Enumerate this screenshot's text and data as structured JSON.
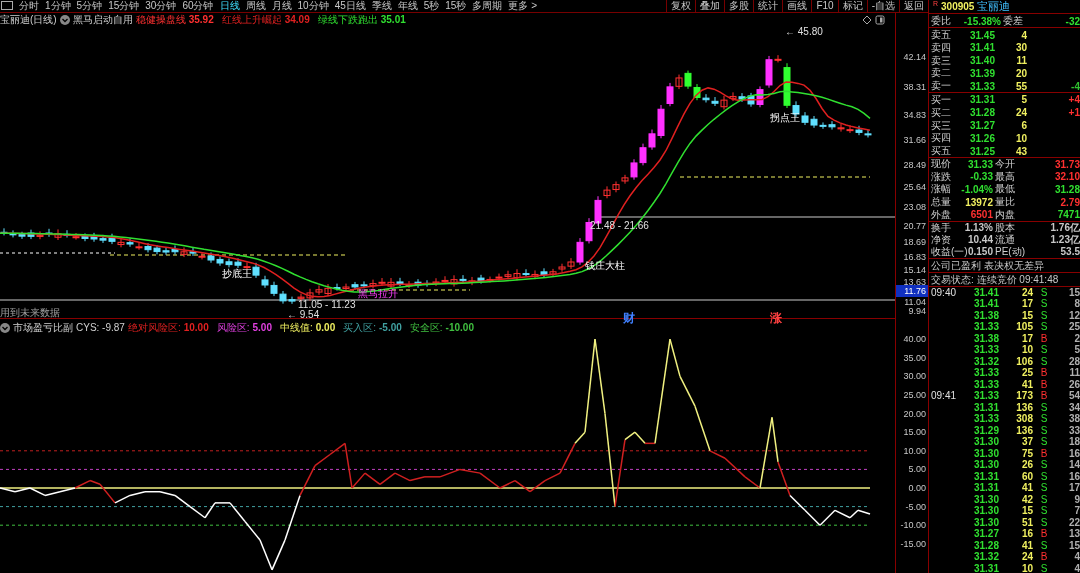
{
  "toolbar": {
    "periods": [
      {
        "label": "分时",
        "selected": false
      },
      {
        "label": "1分钟",
        "selected": false
      },
      {
        "label": "5分钟",
        "selected": false
      },
      {
        "label": "15分钟",
        "selected": false
      },
      {
        "label": "30分钟",
        "selected": false
      },
      {
        "label": "60分钟",
        "selected": false
      },
      {
        "label": "日线",
        "selected": true
      },
      {
        "label": "周线",
        "selected": false
      },
      {
        "label": "月线",
        "selected": false
      },
      {
        "label": "10分钟",
        "selected": false
      },
      {
        "label": "45日线",
        "selected": false
      },
      {
        "label": "季线",
        "selected": false
      },
      {
        "label": "年线",
        "selected": false
      },
      {
        "label": "5秒",
        "selected": false
      },
      {
        "label": "15秒",
        "selected": false
      },
      {
        "label": "多周期",
        "selected": false
      }
    ],
    "more": "更多 >",
    "tools": [
      "复权",
      "叠加",
      "多股",
      "统计",
      "画线",
      "F10",
      "标记",
      "-自选",
      "返回"
    ]
  },
  "price_chart": {
    "title": "宝丽迪(日线)",
    "indicator": "黑马启动自用",
    "readings": [
      {
        "label": "稳健操盘线",
        "value": "35.92",
        "color": "#ff3030"
      },
      {
        "label": "红线上升崛起",
        "value": "34.09",
        "color": "#e02020"
      },
      {
        "label": "绿线下跌跑出",
        "value": "35.01",
        "color": "#30e030"
      }
    ],
    "annotations": [
      {
        "text": "← 45.80",
        "kind": "price"
      },
      {
        "text": "拐点王",
        "kind": "signal"
      },
      {
        "text": "21.48 - 21.66",
        "kind": "price"
      },
      {
        "text": "钱庄大柱",
        "kind": "signal"
      },
      {
        "text": "抄底王",
        "kind": "signal"
      },
      {
        "text": "黑马拉升",
        "kind": "highlight"
      },
      {
        "text": "11.05 - 11.23",
        "kind": "price"
      },
      {
        "text": "← 9.54",
        "kind": "price"
      },
      {
        "text": "用到未来数据",
        "kind": "note"
      }
    ],
    "axis_ticks": [
      "42.14",
      "38.31",
      "34.83",
      "31.66",
      "28.49",
      "25.64",
      "23.08",
      "20.77",
      "18.69",
      "16.83",
      "15.14",
      "13.63",
      "11.04",
      "9.94"
    ],
    "current_price_tag": "11.76",
    "events": [
      {
        "text": "财",
        "color": "#4080ff"
      },
      {
        "text": "涨",
        "color": "#ff4040"
      }
    ]
  },
  "indicator": {
    "name": "市场盈亏比副",
    "value": "CYS: -9.87",
    "readings": [
      {
        "label": "绝对风险区:",
        "value": "10.00",
        "color": "#e02020"
      },
      {
        "label": "风险区:",
        "value": "5.00",
        "color": "#e040e0"
      },
      {
        "label": "中线值:",
        "value": "0.00",
        "color": "#f0f060"
      },
      {
        "label": "买入区:",
        "value": "-5.00",
        "color": "#40a0a0"
      },
      {
        "label": "安全区:",
        "value": "-10.00",
        "color": "#40c040"
      }
    ],
    "axis_ticks": [
      "40.00",
      "35.00",
      "30.00",
      "25.00",
      "20.00",
      "15.00",
      "10.00",
      "5.00",
      "0.00",
      "-5.00",
      "-10.00",
      "-15.00"
    ]
  },
  "quote": {
    "flag": "R",
    "code": "300905",
    "name": "宝丽迪",
    "ratio": [
      {
        "label": "委比",
        "value": "-15.38%",
        "color": "#30e030"
      },
      {
        "label": "委差",
        "value": "-32",
        "color": "#30e030"
      }
    ],
    "sell": [
      {
        "label": "卖五",
        "price": "31.45",
        "volume": "4"
      },
      {
        "label": "卖四",
        "price": "31.41",
        "volume": "30"
      },
      {
        "label": "卖三",
        "price": "31.40",
        "volume": "11"
      },
      {
        "label": "卖二",
        "price": "31.39",
        "volume": "20"
      },
      {
        "label": "卖一",
        "price": "31.33",
        "volume": "55",
        "delta": {
          "text": "-4",
          "color": "#30c030"
        }
      }
    ],
    "buy": [
      {
        "label": "买一",
        "price": "31.31",
        "volume": "5",
        "delta": {
          "text": "+4",
          "color": "#ff3030"
        }
      },
      {
        "label": "买二",
        "price": "31.28",
        "volume": "24",
        "delta": {
          "text": "+1",
          "color": "#ff3030"
        }
      },
      {
        "label": "买三",
        "price": "31.27",
        "volume": "6"
      },
      {
        "label": "买四",
        "price": "31.26",
        "volume": "10"
      },
      {
        "label": "买五",
        "price": "31.25",
        "volume": "43"
      }
    ],
    "stats": [
      {
        "label": "现价",
        "value": "31.33",
        "color": "#30e030"
      },
      {
        "label": "今开",
        "value": "31.73",
        "color": "#ff3030"
      },
      {
        "label": "涨跌",
        "value": "-0.33",
        "color": "#30e030"
      },
      {
        "label": "最高",
        "value": "32.10",
        "color": "#ff3030"
      },
      {
        "label": "涨幅",
        "value": "-1.04%",
        "color": "#30e030"
      },
      {
        "label": "最低",
        "value": "31.28",
        "color": "#30e030"
      },
      {
        "label": "总量",
        "value": "13972",
        "color": "#f0f060"
      },
      {
        "label": "量比",
        "value": "2.79",
        "color": "#ff3030"
      },
      {
        "label": "外盘",
        "value": "6501",
        "color": "#ff3030"
      },
      {
        "label": "内盘",
        "value": "7471",
        "color": "#30e030"
      }
    ],
    "fundamentals": [
      {
        "label": "换手",
        "value": "1.13%"
      },
      {
        "label": "股本",
        "value": "1.76亿"
      },
      {
        "label": "净资",
        "value": "10.44"
      },
      {
        "label": "流通",
        "value": "1.23亿"
      },
      {
        "label": "收益(一)",
        "value": "0.150"
      },
      {
        "label": "PE(动)",
        "value": "53.5"
      }
    ],
    "notice": "公司已盈利 表决权无差异",
    "status": "交易状态: 连续竞价 09:41:48"
  },
  "ticks": [
    {
      "time": "09:40",
      "price": "31.41",
      "volume": "24",
      "side": "S",
      "kind": "sell",
      "count": "15"
    },
    {
      "price": "31.41",
      "volume": "17",
      "side": "S",
      "kind": "sell",
      "count": "8"
    },
    {
      "price": "31.38",
      "volume": "15",
      "side": "S",
      "kind": "sell",
      "count": "12"
    },
    {
      "price": "31.33",
      "volume": "105",
      "side": "S",
      "kind": "sell",
      "count": "25"
    },
    {
      "price": "31.38",
      "volume": "17",
      "side": "B",
      "kind": "buy",
      "count": "2"
    },
    {
      "price": "31.33",
      "volume": "10",
      "side": "S",
      "kind": "sell",
      "count": "5"
    },
    {
      "price": "31.32",
      "volume": "106",
      "side": "S",
      "kind": "sell",
      "count": "28"
    },
    {
      "price": "31.33",
      "volume": "25",
      "side": "B",
      "kind": "buy",
      "count": "11"
    },
    {
      "price": "31.33",
      "volume": "41",
      "side": "B",
      "kind": "buy",
      "count": "26"
    },
    {
      "time": "09:41",
      "price": "31.33",
      "volume": "173",
      "side": "B",
      "kind": "buy",
      "count": "54"
    },
    {
      "price": "31.31",
      "volume": "136",
      "side": "S",
      "kind": "sell",
      "count": "34"
    },
    {
      "price": "31.33",
      "volume": "308",
      "side": "S",
      "kind": "sell",
      "count": "38"
    },
    {
      "price": "31.29",
      "volume": "136",
      "side": "S",
      "kind": "sell",
      "count": "33"
    },
    {
      "price": "31.30",
      "volume": "37",
      "side": "S",
      "kind": "sell",
      "count": "18"
    },
    {
      "price": "31.30",
      "volume": "75",
      "side": "B",
      "kind": "buy",
      "count": "16"
    },
    {
      "price": "31.30",
      "volume": "26",
      "side": "S",
      "kind": "sell",
      "count": "14"
    },
    {
      "price": "31.31",
      "volume": "60",
      "side": "S",
      "kind": "sell",
      "count": "16"
    },
    {
      "price": "31.31",
      "volume": "41",
      "side": "S",
      "kind": "sell",
      "count": "17"
    },
    {
      "price": "31.30",
      "volume": "42",
      "side": "S",
      "kind": "sell",
      "count": "9"
    },
    {
      "price": "31.30",
      "volume": "15",
      "side": "S",
      "kind": "sell",
      "count": "7"
    },
    {
      "price": "31.30",
      "volume": "51",
      "side": "S",
      "kind": "sell",
      "count": "22"
    },
    {
      "price": "31.27",
      "volume": "16",
      "side": "B",
      "kind": "buy",
      "count": "13"
    },
    {
      "price": "31.28",
      "volume": "41",
      "side": "S",
      "kind": "sell",
      "count": "15"
    },
    {
      "price": "31.32",
      "volume": "24",
      "side": "B",
      "kind": "buy",
      "count": "4"
    },
    {
      "price": "31.31",
      "volume": "10",
      "side": "S",
      "kind": "sell",
      "count": "4"
    }
  ]
}
